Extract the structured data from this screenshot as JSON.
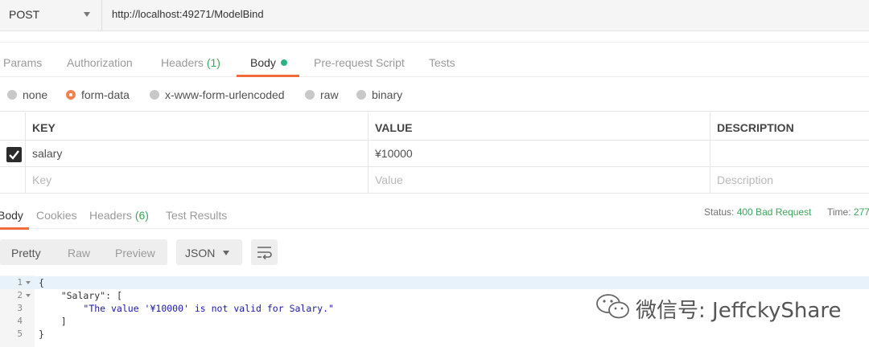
{
  "request": {
    "method": "POST",
    "url": "http://localhost:49271/ModelBind"
  },
  "request_tabs": [
    {
      "label": "Params"
    },
    {
      "label": "Authorization"
    },
    {
      "label": "Headers",
      "count": "(1)"
    },
    {
      "label": "Body"
    },
    {
      "label": "Pre-request Script"
    },
    {
      "label": "Tests"
    }
  ],
  "body_types": [
    "none",
    "form-data",
    "x-www-form-urlencoded",
    "raw",
    "binary"
  ],
  "body_selected": "form-data",
  "form_table": {
    "headers": [
      "KEY",
      "VALUE",
      "DESCRIPTION"
    ],
    "rows": [
      {
        "checked": true,
        "key": "salary",
        "value": "¥10000",
        "description": ""
      }
    ],
    "placeholders": {
      "key": "Key",
      "value": "Value",
      "description": "Description"
    }
  },
  "response_tabs": [
    {
      "label": "Body"
    },
    {
      "label": "Cookies"
    },
    {
      "label": "Headers",
      "count": "(6)"
    },
    {
      "label": "Test Results"
    }
  ],
  "status": {
    "status_label": "Status:",
    "status_value": "400 Bad Request",
    "time_label": "Time:",
    "time_value": "277"
  },
  "view_modes": [
    "Pretty",
    "Raw",
    "Preview"
  ],
  "format": "JSON",
  "code_lines": [
    {
      "n": "1",
      "text": "{"
    },
    {
      "n": "2",
      "key": "\"Salary\"",
      "text": ": ["
    },
    {
      "n": "3",
      "str": "\"The value '¥10000' is not valid for Salary.\""
    },
    {
      "n": "4",
      "text": "]"
    },
    {
      "n": "5",
      "text": "}"
    }
  ],
  "watermark": "微信号: JeffckyShare",
  "colors": {
    "accent": "#f26b3a",
    "success": "#3ea55a",
    "active_dot": "#26b47f",
    "string": "#1a1aa6"
  },
  "icons": {
    "method_dropdown": "chevron-down-icon",
    "wrap": "wrap-lines-icon",
    "checkbox": "checkmark-icon",
    "watermark": "wechat-icon"
  }
}
